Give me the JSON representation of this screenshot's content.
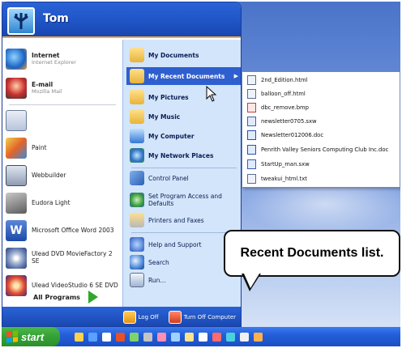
{
  "user": {
    "name": "Tom"
  },
  "pinned": [
    {
      "title": "Internet",
      "subtitle": "Internet Explorer",
      "icon": "internet-explorer-icon"
    },
    {
      "title": "E-mail",
      "subtitle": "Mozilla Mail",
      "icon": "mozilla-mail-icon"
    }
  ],
  "recent_programs": [
    {
      "label": "",
      "icon": "notepad-icon"
    },
    {
      "label": "Paint",
      "icon": "paint-icon"
    },
    {
      "label": "Webbuilder",
      "icon": "webbuilder-icon"
    },
    {
      "label": "Eudora Light",
      "icon": "eudora-icon"
    },
    {
      "label": "Microsoft Office Word 2003",
      "icon": "word-icon"
    },
    {
      "label": "Ulead DVD MovieFactory 2 SE",
      "icon": "dvd-moviefactory-icon"
    },
    {
      "label": "Ulead VideoStudio 6 SE DVD",
      "icon": "videostudio-icon"
    }
  ],
  "all_programs": {
    "label": "All Programs"
  },
  "places": [
    {
      "label": "My Documents",
      "icon": "my-documents-icon",
      "bold": true
    },
    {
      "label": "My Recent Documents",
      "icon": "recent-documents-icon",
      "bold": true,
      "highlighted": true,
      "caret": "▶"
    },
    {
      "label": "My Pictures",
      "icon": "my-pictures-icon",
      "bold": true
    },
    {
      "label": "My Music",
      "icon": "my-music-icon",
      "bold": true
    },
    {
      "label": "My Computer",
      "icon": "my-computer-icon",
      "bold": true
    },
    {
      "label": "My Network Places",
      "icon": "network-places-icon",
      "bold": true
    },
    {
      "label": "Control Panel",
      "icon": "control-panel-icon"
    },
    {
      "label": "Set Program Access and Defaults",
      "icon": "program-access-icon"
    },
    {
      "label": "Printers and Faxes",
      "icon": "printers-icon"
    },
    {
      "label": "Help and Support",
      "icon": "help-icon"
    },
    {
      "label": "Search",
      "icon": "search-icon"
    },
    {
      "label": "Run...",
      "icon": "run-icon"
    }
  ],
  "recent_documents": [
    {
      "label": "2nd_Edition.html",
      "icon": "html-file-icon"
    },
    {
      "label": "balloon_off.html",
      "icon": "html-file-icon"
    },
    {
      "label": "dbc_remove.bmp",
      "icon": "bmp-file-icon"
    },
    {
      "label": "newsletter0705.sxw",
      "icon": "sxw-file-icon"
    },
    {
      "label": "Newsletter012006.doc",
      "icon": "doc-file-icon"
    },
    {
      "label": "Penrith Valley Seniors Computing Club Inc.doc",
      "icon": "doc-file-icon"
    },
    {
      "label": "StartUp_man.sxw",
      "icon": "sxw-file-icon"
    },
    {
      "label": "tweakui_html.txt",
      "icon": "txt-file-icon"
    }
  ],
  "footer": {
    "logoff": "Log Off",
    "turnoff": "Turn Off Computer"
  },
  "taskbar": {
    "start_label": "start"
  },
  "callout": {
    "text": "Recent Documents list."
  },
  "colors": {
    "header_blue": "#2a63d6",
    "highlight": "#2f5fcf",
    "start_green": "#34a034",
    "right_pane": "#d3e5fa"
  }
}
